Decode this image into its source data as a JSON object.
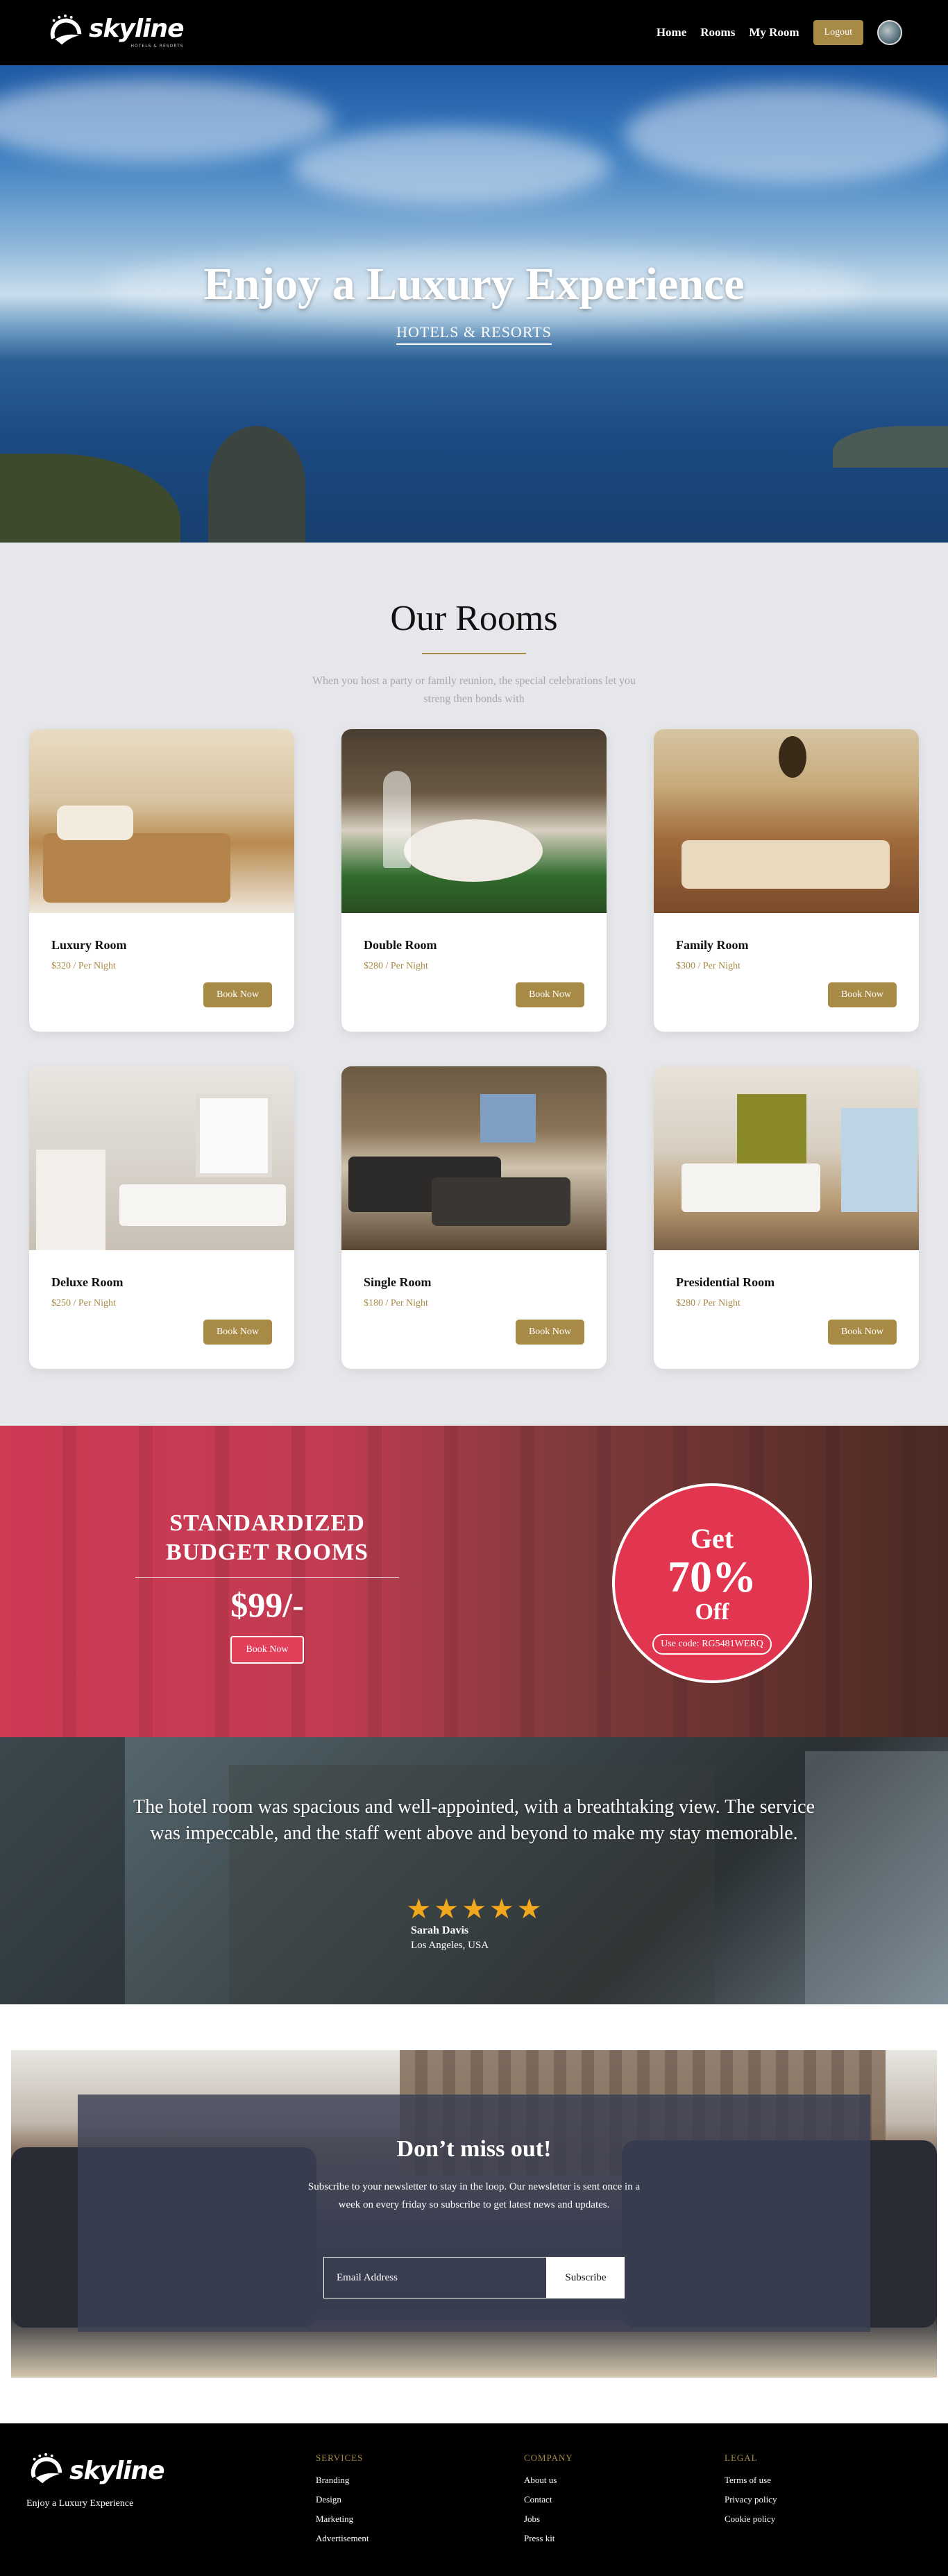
{
  "nav": {
    "brand": "skyline",
    "brand_sub": "HOTELS & RESORTS",
    "links": [
      "Home",
      "Rooms",
      "My Room"
    ],
    "logout": "Logout"
  },
  "hero": {
    "title": "Enjoy a Luxury Experience",
    "subtitle": "HOTELS & RESORTS"
  },
  "rooms": {
    "title": "Our Rooms",
    "description": "When you host a party or family reunion, the special celebrations let you streng then bonds with",
    "items": [
      {
        "name": "Luxury Room",
        "price": "$320 / Per Night",
        "button": "Book Now"
      },
      {
        "name": "Double Room",
        "price": "$280 / Per Night",
        "button": "Book Now"
      },
      {
        "name": "Family Room",
        "price": "$300 / Per Night",
        "button": "Book Now"
      },
      {
        "name": "Deluxe Room",
        "price": "$250 / Per Night",
        "button": "Book Now"
      },
      {
        "name": "Single Room",
        "price": "$180 / Per Night",
        "button": "Book Now"
      },
      {
        "name": "Presidential Room",
        "price": "$280 / Per Night",
        "button": "Book Now"
      }
    ]
  },
  "promo": {
    "heading_line1": "STANDARDIZED",
    "heading_line2": "BUDGET ROOMS",
    "price": "$99/-",
    "button": "Book Now",
    "get": "Get",
    "percent": "70%",
    "off": "Off",
    "code": "Use code: RG5481WERQ"
  },
  "testimonial": {
    "quote": "The hotel room was spacious and well-appointed, with a breathtaking view. The service was impeccable, and the staff went above and beyond to make my stay memorable.",
    "rating": 5,
    "name": "Sarah Davis",
    "location": "Los Angeles, USA"
  },
  "newsletter": {
    "title": "Don’t miss out!",
    "text": "Subscribe to your newsletter to stay in the loop. Our newsletter is sent once in a week on every friday so subscribe to get latest news and updates.",
    "placeholder": "Email Address",
    "button": "Subscribe"
  },
  "footer": {
    "brand": "skyline",
    "tagline": "Enjoy a Luxury Experience",
    "services": {
      "heading": "SERVICES",
      "links": [
        "Branding",
        "Design",
        "Marketing",
        "Advertisement"
      ]
    },
    "company": {
      "heading": "COMPANY",
      "links": [
        "About us",
        "Contact",
        "Jobs",
        "Press kit"
      ]
    },
    "legal": {
      "heading": "LEGAL",
      "links": [
        "Terms of use",
        "Privacy policy",
        "Cookie policy"
      ]
    }
  },
  "colors": {
    "accent": "#a78a46",
    "promo_red": "#e23650",
    "star": "#f2a81d"
  }
}
